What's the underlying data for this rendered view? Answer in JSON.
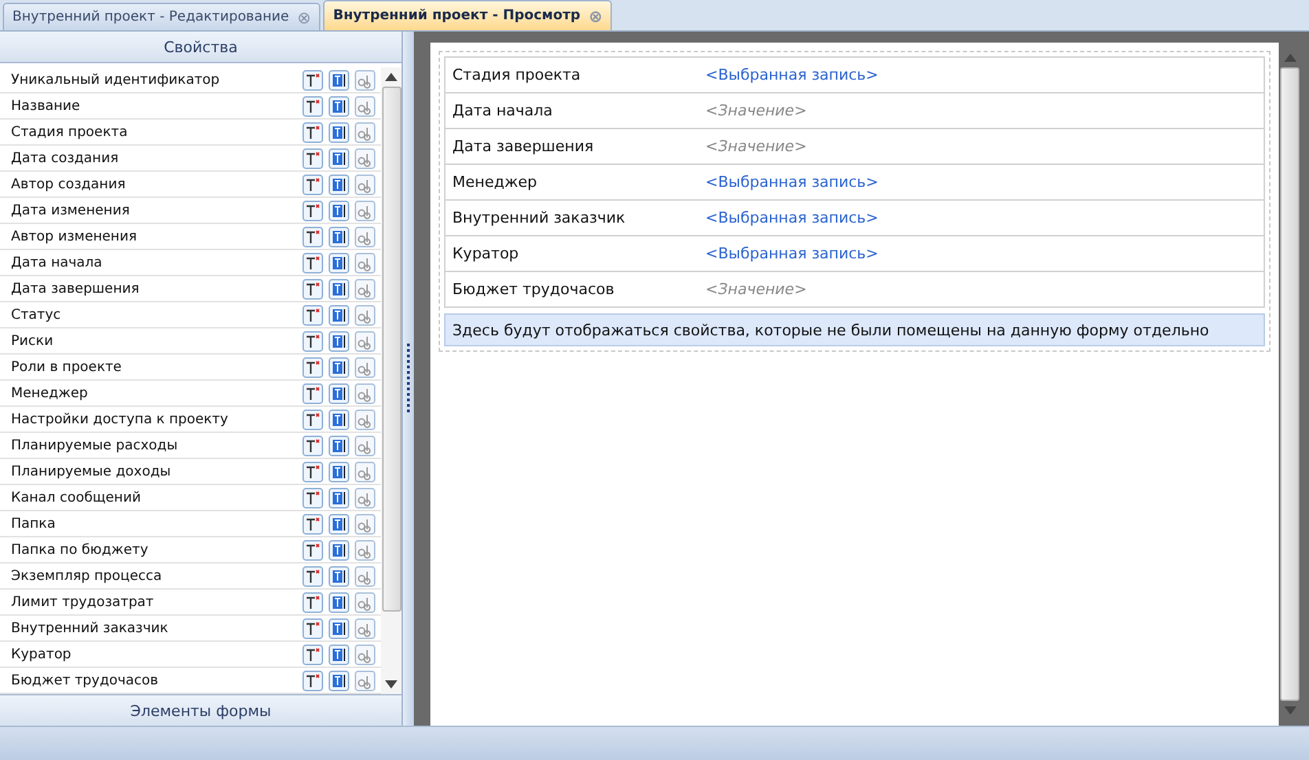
{
  "tabs": [
    {
      "label": "Внутренний проект - Редактирование",
      "selected": false,
      "close": "⊗"
    },
    {
      "label": "Внутренний проект - Просмотр",
      "selected": true,
      "close": "⊗"
    }
  ],
  "properties_panel": {
    "title": "Свойства",
    "footer": "Элементы формы",
    "items": [
      "Уникальный идентификатор",
      "Название",
      "Стадия проекта",
      "Дата создания",
      "Автор создания",
      "Дата изменения",
      "Автор изменения",
      "Дата начала",
      "Дата завершения",
      "Статус",
      "Риски",
      "Роли в проекте",
      "Менеджер",
      "Настройки доступа к проекту",
      "Планируемые расходы",
      "Планируемые доходы",
      "Канал сообщений",
      "Папка",
      "Папка по бюджету",
      "Экземпляр процесса",
      "Лимит трудозатрат",
      "Внутренний заказчик",
      "Куратор",
      "Бюджет трудочасов"
    ]
  },
  "form": {
    "fields": [
      {
        "label": "Стадия проекта",
        "value": "<Выбранная запись>",
        "kind": "link"
      },
      {
        "label": "Дата начала",
        "value": "<Значение>",
        "kind": "placeholder"
      },
      {
        "label": "Дата завершения",
        "value": "<Значение>",
        "kind": "placeholder"
      },
      {
        "label": "Менеджер",
        "value": "<Выбранная запись>",
        "kind": "link"
      },
      {
        "label": "Внутренний заказчик",
        "value": "<Выбранная запись>",
        "kind": "link"
      },
      {
        "label": "Куратор",
        "value": "<Выбранная запись>",
        "kind": "link"
      },
      {
        "label": "Бюджет трудочасов",
        "value": "<Значение>",
        "kind": "placeholder"
      }
    ],
    "note": "Здесь будут отображаться свойства, которые не были помещены на данную форму отдельно"
  }
}
